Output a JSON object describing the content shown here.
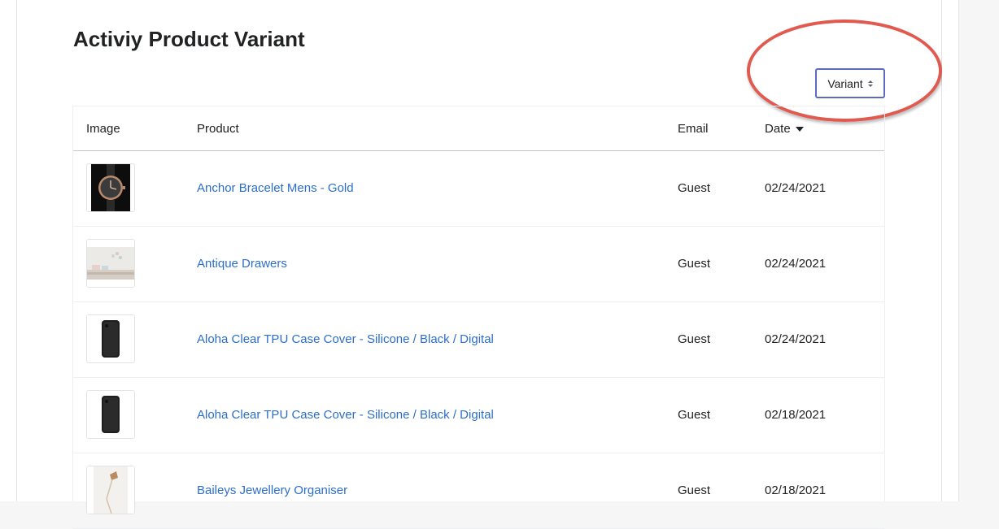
{
  "page": {
    "title": "Activiy Product Variant"
  },
  "filter": {
    "label": "Variant"
  },
  "table": {
    "headers": {
      "image": "Image",
      "product": "Product",
      "email": "Email",
      "date": "Date"
    },
    "rows": [
      {
        "thumbnail": "watch-image",
        "product": "Anchor Bracelet Mens - Gold",
        "email": "Guest",
        "date": "02/24/2021"
      },
      {
        "thumbnail": "room-image",
        "product": "Antique Drawers",
        "email": "Guest",
        "date": "02/24/2021"
      },
      {
        "thumbnail": "phone-case-image",
        "product": "Aloha Clear TPU Case Cover - Silicone / Black / Digital",
        "email": "Guest",
        "date": "02/24/2021"
      },
      {
        "thumbnail": "phone-case-image",
        "product": "Aloha Clear TPU Case Cover - Silicone / Black / Digital",
        "email": "Guest",
        "date": "02/18/2021"
      },
      {
        "thumbnail": "lamp-image",
        "product": "Baileys Jewellery Organiser",
        "email": "Guest",
        "date": "02/18/2021"
      }
    ]
  },
  "colors": {
    "link": "#2c6ecb",
    "select_border": "#5c6ac4",
    "highlight_ring": "#e15a4f"
  }
}
